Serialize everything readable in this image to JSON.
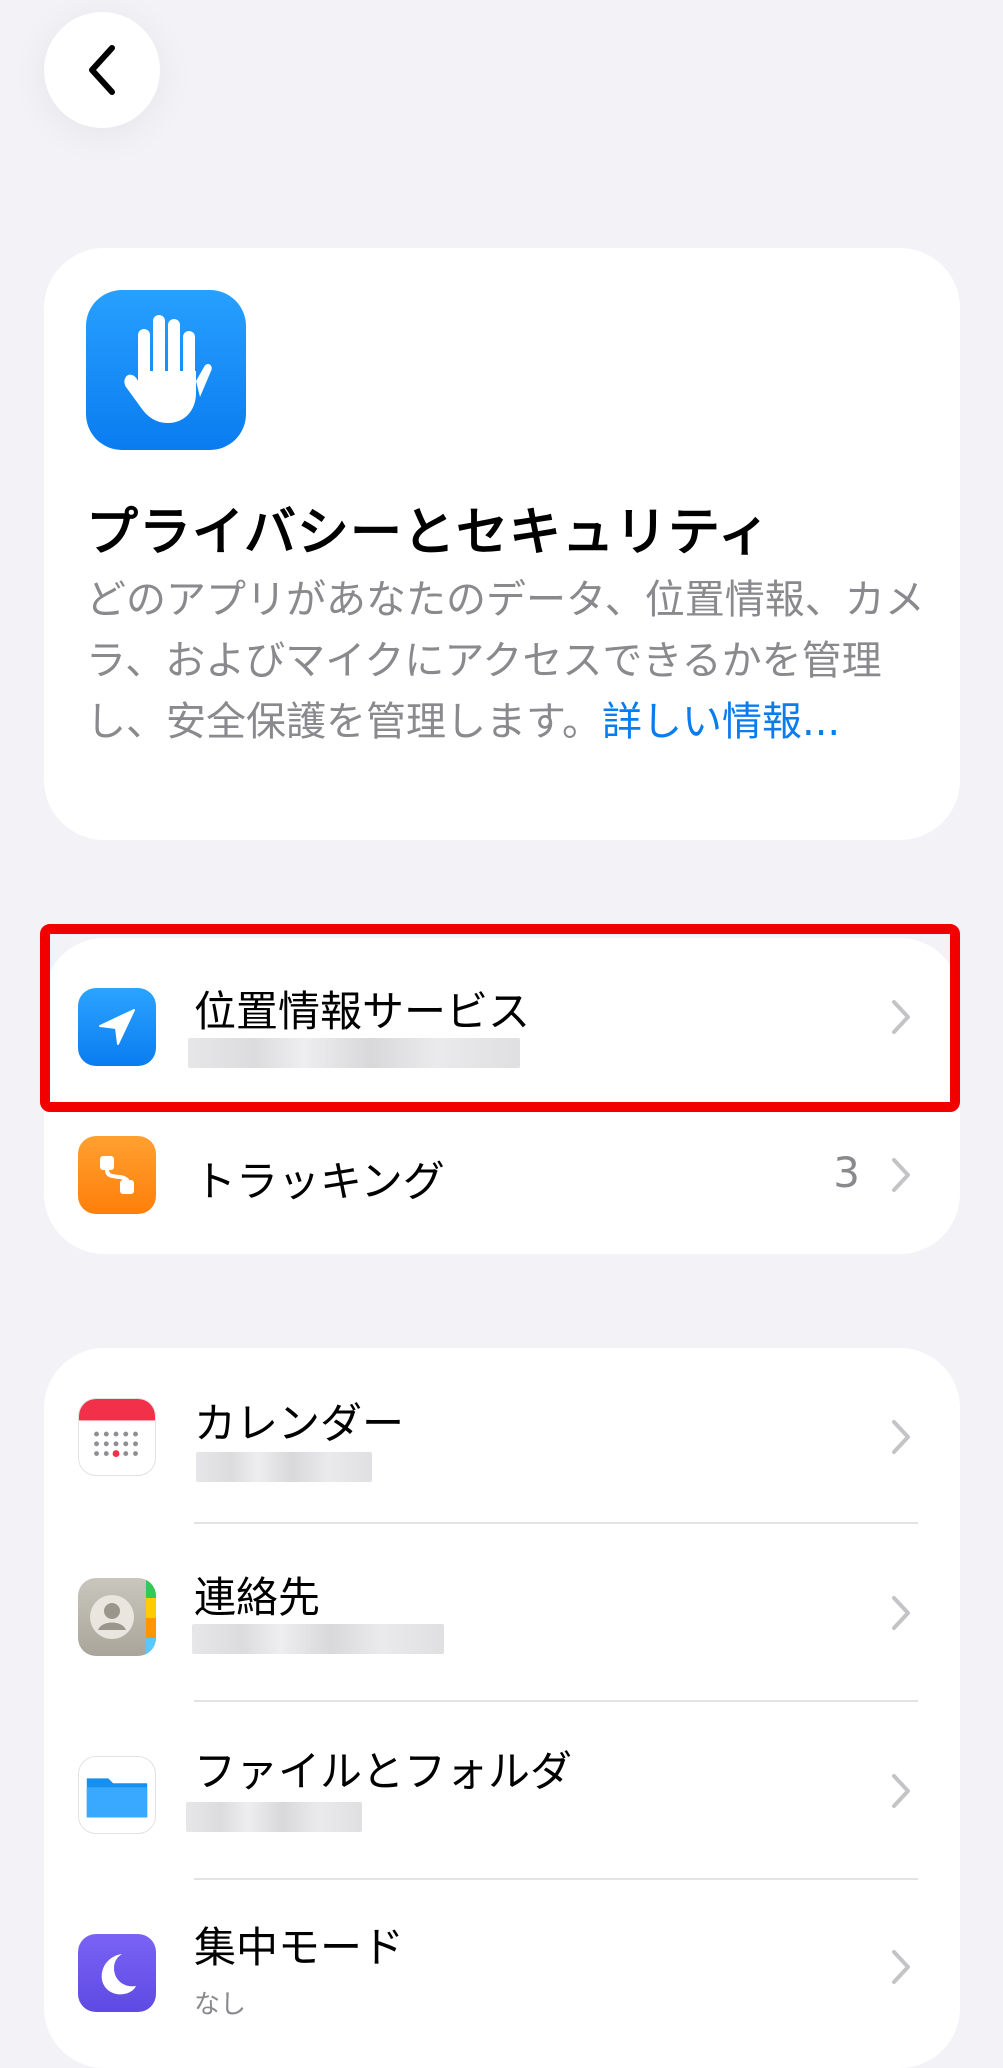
{
  "nav": {
    "back_icon": "chevron-left-icon"
  },
  "hero": {
    "icon": "hand-raised-icon",
    "title": "プライバシーとセキュリティ",
    "description": "どのアプリがあなたのデータ、位置情報、カメラ、およびマイクにアクセスできるかを管理し、安全保護を管理します。",
    "link_text": "詳しい情報..."
  },
  "group1": {
    "items": [
      {
        "label": "位置情報サービス",
        "icon": "location-arrow-icon"
      },
      {
        "label": "トラッキング",
        "icon": "tracking-icon",
        "value": "3"
      }
    ]
  },
  "group2": {
    "items": [
      {
        "label": "カレンダー",
        "icon": "calendar-icon"
      },
      {
        "label": "連絡先",
        "icon": "contacts-icon"
      },
      {
        "label": "ファイルとフォルダ",
        "icon": "folder-icon"
      },
      {
        "label": "集中モード",
        "icon": "moon-icon",
        "sublabel": "なし"
      }
    ]
  },
  "colors": {
    "accent": "#0a7cf0",
    "highlight": "#f20000",
    "background": "#f2f2f7"
  }
}
